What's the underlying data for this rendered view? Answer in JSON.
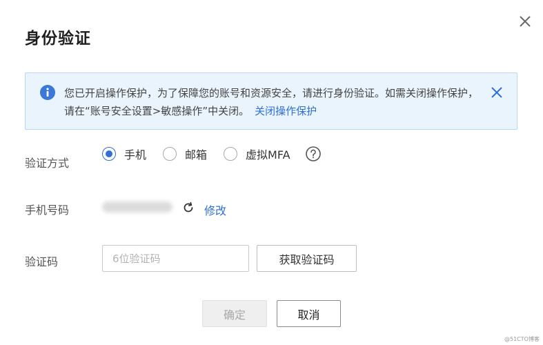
{
  "dialog": {
    "title": "身份验证",
    "close_icon": "close-icon"
  },
  "notice": {
    "icon": "info-icon",
    "text": "您已开启操作保护，为了保障您的账号和资源安全，请进行身份验证。如需关闭操作保护，请在“账号安全设置>敏感操作”中关闭。",
    "link": "关闭操作保护",
    "close_icon": "close-icon",
    "background": "#eaf4fd",
    "border": "#b7d8f6",
    "accent": "#2f6fd6"
  },
  "verify_method": {
    "label": "验证方式",
    "options": [
      {
        "label": "手机",
        "checked": true
      },
      {
        "label": "邮箱",
        "checked": false
      },
      {
        "label": "虚拟MFA",
        "checked": false
      }
    ],
    "help_icon": "question-circle-icon"
  },
  "phone": {
    "label": "手机号码",
    "refresh_icon": "refresh-icon",
    "edit_link": "修改"
  },
  "code": {
    "label": "验证码",
    "placeholder": "6位验证码",
    "value": "",
    "get_code_button": "获取验证码"
  },
  "footer": {
    "ok_button": "确定",
    "cancel_button": "取消"
  },
  "watermark": "@51CTO博客"
}
